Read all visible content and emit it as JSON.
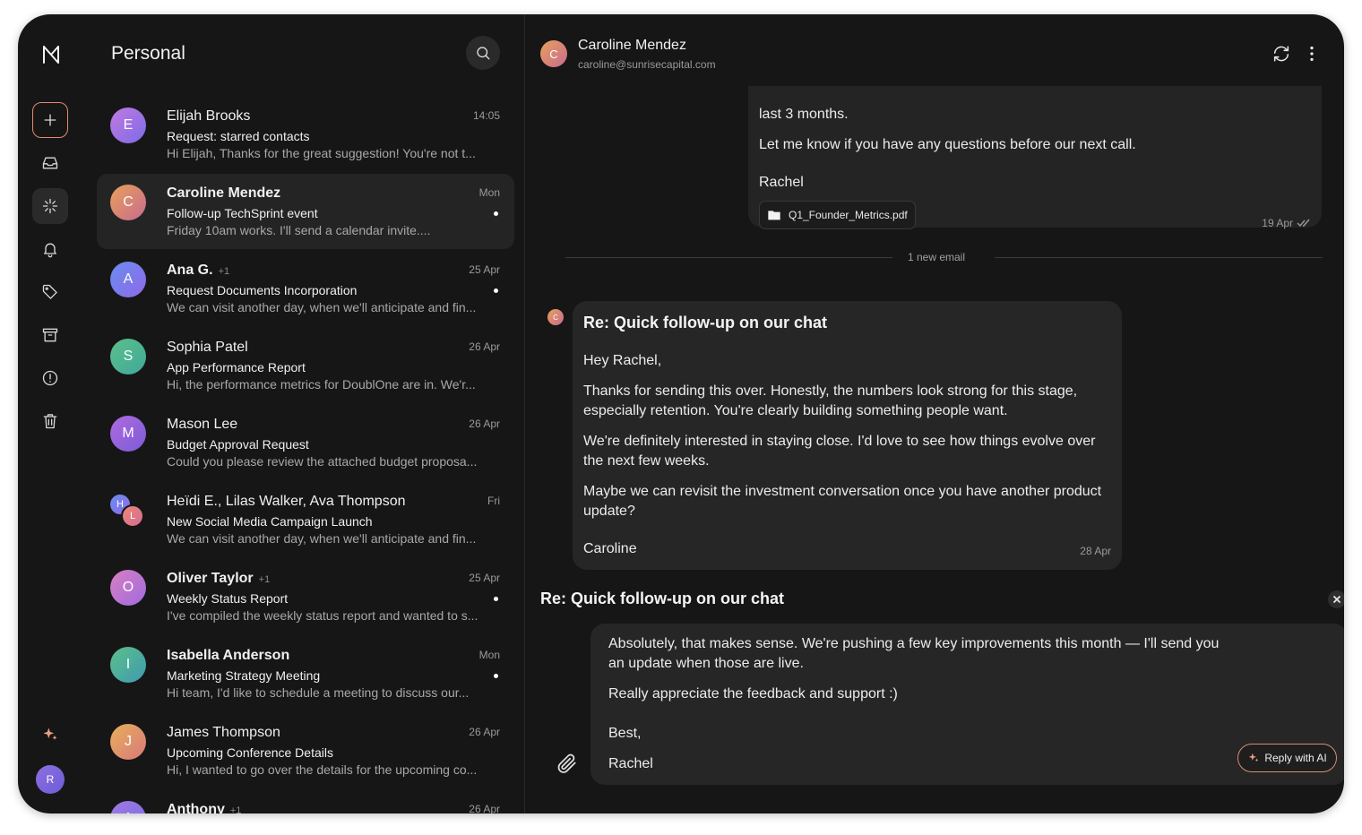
{
  "colors": {
    "accent": "#e08a6e",
    "background": "#161616",
    "card": "#262626"
  },
  "rail": {
    "items": [
      {
        "name": "compose",
        "icon": "plus-icon"
      },
      {
        "name": "inbox",
        "icon": "inbox-icon"
      },
      {
        "name": "magic",
        "icon": "sparkle-burst-icon"
      },
      {
        "name": "notifications",
        "icon": "bell-icon"
      },
      {
        "name": "labels",
        "icon": "tag-icon"
      },
      {
        "name": "archive",
        "icon": "archive-icon"
      },
      {
        "name": "spam",
        "icon": "alert-circle-icon"
      },
      {
        "name": "trash",
        "icon": "trash-icon"
      }
    ],
    "ai_icon": "sparkles-icon",
    "user_initial": "R"
  },
  "list": {
    "title": "Personal",
    "emails": [
      {
        "initial": "E",
        "name": "Elijah Brooks",
        "count": "",
        "time": "14:05",
        "subject": "Request: starred contacts",
        "preview": "Hi Elijah, Thanks for the great suggestion! You're not t...",
        "unread": false
      },
      {
        "initial": "C",
        "name": "Caroline Mendez",
        "count": "",
        "time": "Mon",
        "subject": "Follow-up TechSprint event",
        "preview": "Friday 10am works. I'll send a calendar invite....",
        "unread": true
      },
      {
        "initial": "A",
        "name": "Ana G.",
        "count": "+1",
        "time": "25 Apr",
        "subject": "Request Documents Incorporation",
        "preview": "We can visit another day, when we'll anticipate and fin...",
        "unread": true
      },
      {
        "initial": "S",
        "name": "Sophia Patel",
        "count": "",
        "time": "26 Apr",
        "subject": "App Performance Report",
        "preview": "Hi, the performance metrics for DoublOne are in. We'r...",
        "unread": false
      },
      {
        "initial": "M",
        "name": "Mason Lee",
        "count": "",
        "time": "26 Apr",
        "subject": "Budget Approval Request",
        "preview": "Could you please review the attached budget proposa...",
        "unread": false
      },
      {
        "initial": "H",
        "initial2": "L",
        "name": "Heïdi E., Lilas Walker, Ava Thompson",
        "count": "",
        "time": "Fri",
        "subject": "New Social Media Campaign Launch",
        "preview": "We can visit another day, when we'll anticipate and fin...",
        "unread": false
      },
      {
        "initial": "O",
        "name": "Oliver Taylor",
        "count": "+1",
        "time": "25 Apr",
        "subject": "Weekly Status Report",
        "preview": "I've compiled the weekly status report and wanted to s...",
        "unread": true
      },
      {
        "initial": "I",
        "name": "Isabella Anderson",
        "count": "",
        "time": "Mon",
        "subject": "Marketing Strategy Meeting",
        "preview": "Hi team, I'd like to schedule a meeting to discuss our...",
        "unread": true
      },
      {
        "initial": "J",
        "name": "James Thompson",
        "count": "",
        "time": "26 Apr",
        "subject": "Upcoming Conference Details",
        "preview": "Hi, I wanted to go over the details for the upcoming co...",
        "unread": false
      },
      {
        "initial": "A",
        "name": "Anthony",
        "count": "+1",
        "time": "26 Apr",
        "subject": "",
        "preview": "",
        "unread": true
      }
    ]
  },
  "pane": {
    "sender_initial": "C",
    "sender_name": "Caroline Mendez",
    "sender_email": "caroline@sunrisecapital.com",
    "previous": {
      "line1": "last 3 months.",
      "line2": "Let me know if you have any questions before our next call.",
      "signoff": "Rachel",
      "attachment": "Q1_Founder_Metrics.pdf",
      "date": "19 Apr"
    },
    "divider_label": "1 new email",
    "incoming": {
      "initial": "C",
      "subject": "Re: Quick follow-up on our chat",
      "greeting": "Hey Rachel,",
      "para1": "Thanks for sending this over. Honestly, the numbers look strong for this stage, especially retention. You're clearly building something people want.",
      "para2": "We're definitely interested in staying close. I'd love to see how things evolve over the next few weeks.",
      "para3": "Maybe we can revisit the investment conversation once you have another product update?",
      "signoff": "Caroline",
      "date": "28 Apr"
    },
    "reply": {
      "subject": "Re: Quick follow-up on our chat",
      "para1": "Absolutely, that makes sense. We're pushing a few key improvements this month — I'll send you an update when those are live.",
      "para2": "Really appreciate the feedback and support :)",
      "closing": "Best,",
      "name": "Rachel",
      "ai_button": "Reply with AI"
    }
  }
}
